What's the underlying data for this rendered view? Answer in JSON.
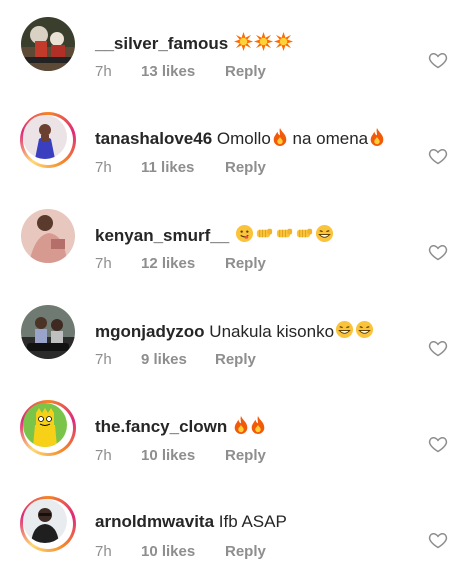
{
  "comments": [
    {
      "username": "__silver_famous",
      "text": "",
      "emojis": [
        "collision",
        "collision",
        "collision"
      ],
      "time": "7h",
      "likes": "13 likes",
      "reply": "Reply",
      "story_ring": false
    },
    {
      "username": "tanashalove46",
      "text": "Omollo",
      "text2": "na omena",
      "emojis_mid": [
        "fire"
      ],
      "emojis": [
        "fire"
      ],
      "time": "7h",
      "likes": "11 likes",
      "reply": "Reply",
      "story_ring": true
    },
    {
      "username": "kenyan_smurf__",
      "text": "",
      "emojis": [
        "yum-face",
        "fist",
        "fist",
        "fist",
        "grin"
      ],
      "time": "7h",
      "likes": "12 likes",
      "reply": "Reply",
      "story_ring": false
    },
    {
      "username": "mgonjadyzoo",
      "text": "Unakula kisonko",
      "emojis": [
        "grin",
        "grin"
      ],
      "time": "7h",
      "likes": "9 likes",
      "reply": "Reply",
      "story_ring": false
    },
    {
      "username": "the.fancy_clown",
      "text": "",
      "emojis": [
        "fire",
        "fire"
      ],
      "time": "7h",
      "likes": "10 likes",
      "reply": "Reply",
      "story_ring": true
    },
    {
      "username": "arnoldmwavita",
      "text": "Ifb ASAP",
      "emojis": [],
      "time": "7h",
      "likes": "10 likes",
      "reply": "Reply",
      "story_ring": true
    }
  ],
  "colors": {
    "text": "#262626",
    "muted": "#8e8e8e",
    "ring_start": "#f58529",
    "ring_end": "#dd2a7b"
  }
}
